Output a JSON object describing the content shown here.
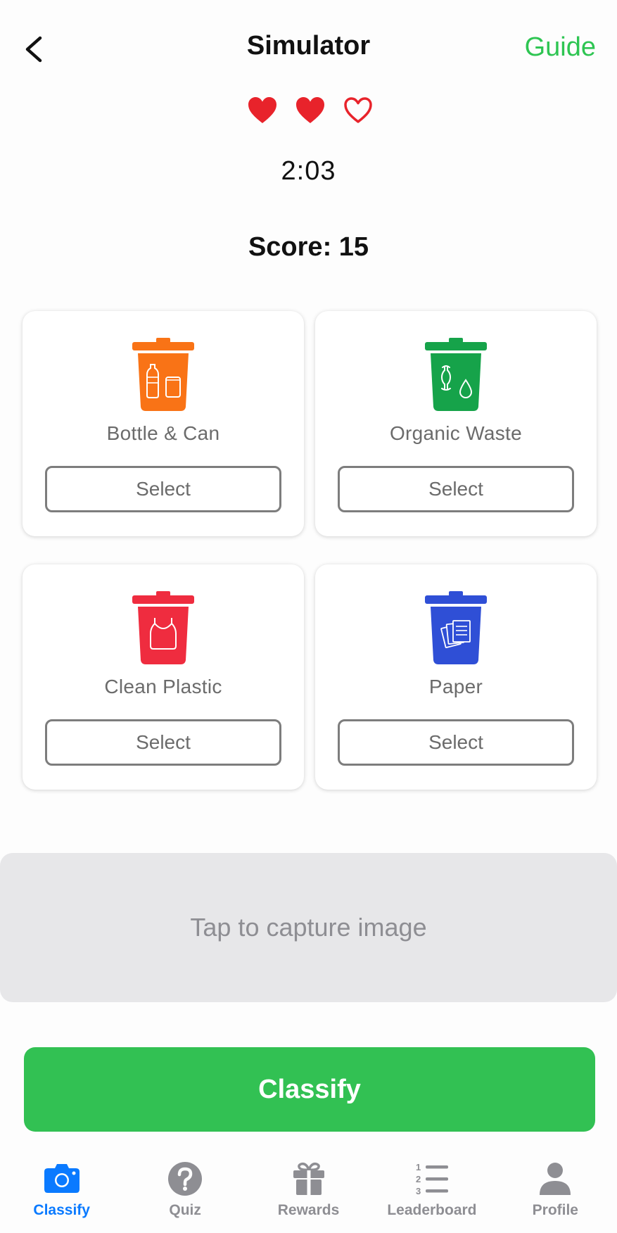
{
  "header": {
    "title": "Simulator",
    "guide_label": "Guide"
  },
  "game": {
    "lives_total": 3,
    "lives_remaining": 2,
    "timer": "2:03",
    "score_text": "Score: 15"
  },
  "bins": [
    {
      "label": "Bottle & Can",
      "select_label": "Select",
      "color": "#f97316"
    },
    {
      "label": "Organic Waste",
      "select_label": "Select",
      "color": "#16a34a"
    },
    {
      "label": "Clean Plastic",
      "select_label": "Select",
      "color": "#ef2c3f"
    },
    {
      "label": "Paper",
      "select_label": "Select",
      "color": "#2f4fd6"
    }
  ],
  "capture": {
    "text": "Tap to capture image"
  },
  "classify": {
    "label": "Classify",
    "color": "#32c153"
  },
  "tabs": [
    {
      "label": "Classify",
      "icon": "camera-icon",
      "active": true
    },
    {
      "label": "Quiz",
      "icon": "question-icon",
      "active": false
    },
    {
      "label": "Rewards",
      "icon": "gift-icon",
      "active": false
    },
    {
      "label": "Leaderboard",
      "icon": "numbered-list-icon",
      "active": false
    },
    {
      "label": "Profile",
      "icon": "person-icon",
      "active": false
    }
  ],
  "colors": {
    "accent_green": "#2ec552",
    "heart_red": "#e8232b",
    "tab_active": "#0a7aff",
    "tab_inactive": "#8e8e93"
  }
}
